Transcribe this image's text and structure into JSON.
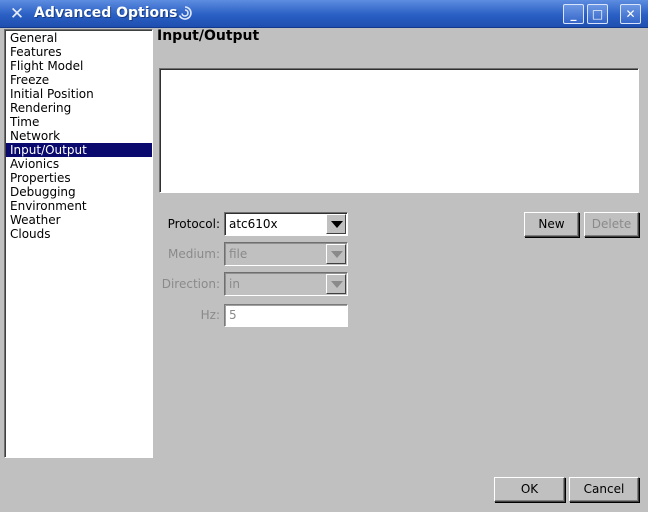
{
  "window": {
    "title": "Advanced Options",
    "app_icon": "x-logo-icon",
    "title_icon": "swirl-icon",
    "minimize_icon": "minimize-icon",
    "maximize_icon": "maximize-icon",
    "close_icon": "close-icon",
    "minimize_glyph": "_",
    "maximize_glyph": "□",
    "close_glyph": "✕",
    "app_glyph": "✕"
  },
  "sidebar": {
    "items": [
      {
        "label": "General"
      },
      {
        "label": "Features"
      },
      {
        "label": "Flight Model"
      },
      {
        "label": "Freeze"
      },
      {
        "label": "Initial Position"
      },
      {
        "label": "Rendering"
      },
      {
        "label": "Time"
      },
      {
        "label": "Network"
      },
      {
        "label": "Input/Output",
        "selected": true
      },
      {
        "label": "Avionics"
      },
      {
        "label": "Properties"
      },
      {
        "label": "Debugging"
      },
      {
        "label": "Environment"
      },
      {
        "label": "Weather"
      },
      {
        "label": "Clouds"
      }
    ]
  },
  "main": {
    "title": "Input/Output",
    "form": {
      "protocol": {
        "label": "Protocol:",
        "value": "atc610x",
        "enabled": true
      },
      "medium": {
        "label": "Medium:",
        "value": "file",
        "enabled": false
      },
      "direction": {
        "label": "Direction:",
        "value": "in",
        "enabled": false
      },
      "hz": {
        "label": "Hz:",
        "value": "5",
        "enabled": false
      }
    },
    "new_label": "New",
    "delete_label": "Delete"
  },
  "footer": {
    "ok_label": "OK",
    "cancel_label": "Cancel"
  },
  "colors": {
    "titlebar": "#2a5fc4",
    "selection": "#0a0a6e",
    "background": "#c0c0c0"
  }
}
